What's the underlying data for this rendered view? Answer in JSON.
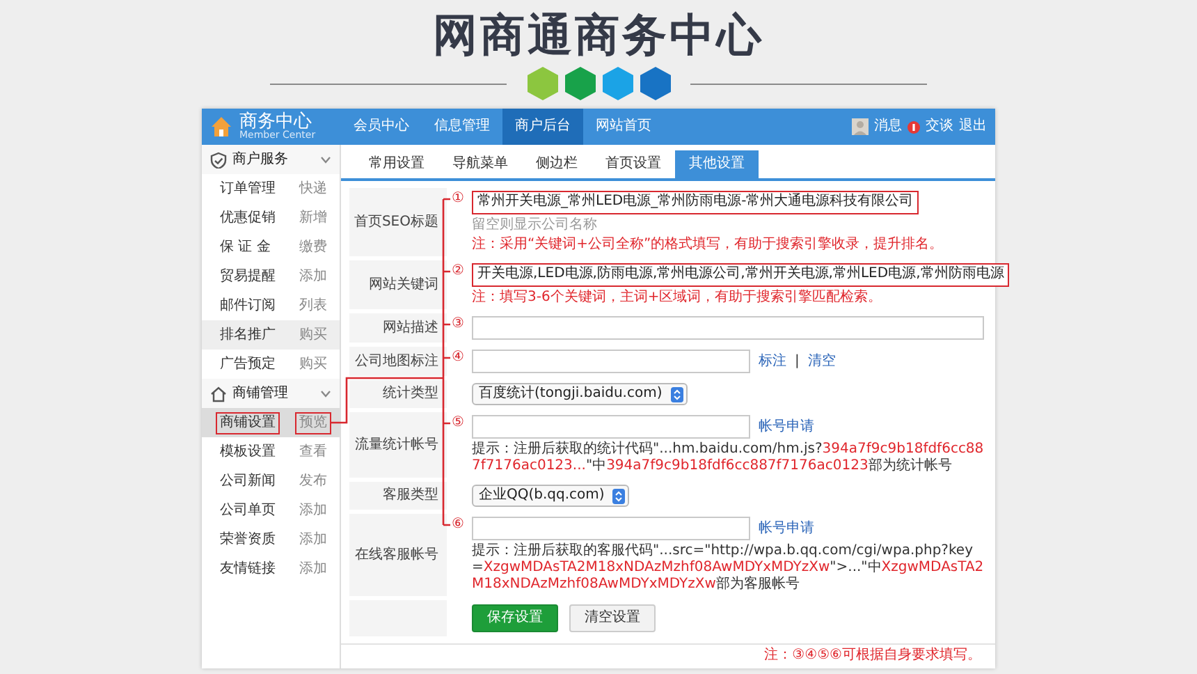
{
  "title": "网商通商务中心",
  "topbar": {
    "logo_title": "商务中心",
    "logo_subtitle": "Member Center",
    "nav": [
      {
        "label": "会员中心",
        "selected": false
      },
      {
        "label": "信息管理",
        "selected": false
      },
      {
        "label": "商户后台",
        "selected": true
      },
      {
        "label": "网站首页",
        "selected": false
      }
    ],
    "message": "消息",
    "chat": "交谈",
    "logout": "退出"
  },
  "sidebar": [
    {
      "title": "商户服务",
      "items": [
        {
          "label": "订单管理",
          "action": "快递",
          "selected": false,
          "hovered": false,
          "annotated": false
        },
        {
          "label": "优惠促销",
          "action": "新增",
          "selected": false,
          "hovered": false,
          "annotated": false
        },
        {
          "label": "保 证 金",
          "action": "缴费",
          "selected": false,
          "hovered": false,
          "annotated": false
        },
        {
          "label": "贸易提醒",
          "action": "添加",
          "selected": false,
          "hovered": false,
          "annotated": false
        },
        {
          "label": "邮件订阅",
          "action": "列表",
          "selected": false,
          "hovered": false,
          "annotated": false
        },
        {
          "label": "排名推广",
          "action": "购买",
          "selected": false,
          "hovered": true,
          "annotated": false
        },
        {
          "label": "广告预定",
          "action": "购买",
          "selected": false,
          "hovered": false,
          "annotated": false
        }
      ]
    },
    {
      "title": "商铺管理",
      "items": [
        {
          "label": "商铺设置",
          "action": "预览",
          "selected": true,
          "hovered": false,
          "annotated": true
        },
        {
          "label": "模板设置",
          "action": "查看",
          "selected": false,
          "hovered": false,
          "annotated": false
        },
        {
          "label": "公司新闻",
          "action": "发布",
          "selected": false,
          "hovered": false,
          "annotated": false
        },
        {
          "label": "公司单页",
          "action": "添加",
          "selected": false,
          "hovered": false,
          "annotated": false
        },
        {
          "label": "荣誉资质",
          "action": "添加",
          "selected": false,
          "hovered": false,
          "annotated": false
        },
        {
          "label": "友情链接",
          "action": "添加",
          "selected": false,
          "hovered": false,
          "annotated": false
        }
      ]
    }
  ],
  "tabs": [
    {
      "label": "常用设置",
      "selected": false
    },
    {
      "label": "导航菜单",
      "selected": false
    },
    {
      "label": "侧边栏",
      "selected": false
    },
    {
      "label": "首页设置",
      "selected": false
    },
    {
      "label": "其他设置",
      "selected": true
    }
  ],
  "form": [
    {
      "kind": "input",
      "label": "首页SEO标题",
      "marker": "①",
      "value": "常州开关电源_常州LED电源_常州防雨电源-常州大通电源科技有限公司",
      "annotated": true,
      "wide": false,
      "aside": "留空则显示公司名称",
      "note": "注：采用“关键词+公司全称”的格式填写，有助于搜索引擎收录，提升排名。"
    },
    {
      "kind": "input",
      "label": "网站关键词",
      "marker": "②",
      "value": "开关电源,LED电源,防雨电源,常州电源公司,常州开关电源,常州LED电源,常州防雨电源",
      "annotated": true,
      "wide": false,
      "note": "注：填写3-6个关键词，主词+区域词，有助于搜索引擎匹配检索。"
    },
    {
      "kind": "input",
      "label": "网站描述",
      "marker": "③",
      "annotated": false,
      "wide": true
    },
    {
      "kind": "input",
      "label": "公司地图标注",
      "marker": "④",
      "annotated": false,
      "wide": false,
      "links": [
        "标注",
        "清空"
      ],
      "separator": "|"
    },
    {
      "kind": "select",
      "label": "统计类型",
      "value": "百度统计(tongji.baidu.com)"
    },
    {
      "kind": "input",
      "label": "流量统计帐号",
      "marker": "⑤",
      "annotated": false,
      "wide": false,
      "links": [
        "帐号申请"
      ],
      "hint": [
        {
          "text": "提示：注册后获取的统计代码\"...hm.baidu.com/hm.js?",
          "highlight": false
        },
        {
          "text": "394a7f9c9b18fdf6cc887f7176ac0123...",
          "highlight": true
        },
        {
          "text": "\"中",
          "highlight": false
        },
        {
          "text": "394a7f9c9b18fdf6cc887f7176ac0123",
          "highlight": true
        },
        {
          "text": "部为统计帐号",
          "highlight": false
        }
      ]
    },
    {
      "kind": "select",
      "label": "客服类型",
      "value": "企业QQ(b.qq.com)"
    },
    {
      "kind": "input",
      "label": "在线客服帐号",
      "marker": "⑥",
      "annotated": false,
      "wide": false,
      "links": [
        "帐号申请"
      ],
      "hint": [
        {
          "text": "提示：注册后获取的客服代码\"...src=\"http://wpa.b.qq.com/cgi/wpa.php?key=",
          "highlight": false
        },
        {
          "text": "XzgwMDAsTA2M18xNDAzMzhf08AwMDYxMDYzXw",
          "highlight": true
        },
        {
          "text": "\">...\"中",
          "highlight": false
        },
        {
          "text": "XzgwMDAsTA2M18xNDAzMzhf08AwMDYxMDYzXw",
          "highlight": true
        },
        {
          "text": "部为客服帐号",
          "highlight": false
        }
      ]
    }
  ],
  "buttons": [
    {
      "label": "保存设置",
      "kind": "primary"
    },
    {
      "label": "清空设置",
      "kind": "secondary"
    }
  ],
  "footnote": "注：③④⑤⑥可根据自身要求填写。"
}
